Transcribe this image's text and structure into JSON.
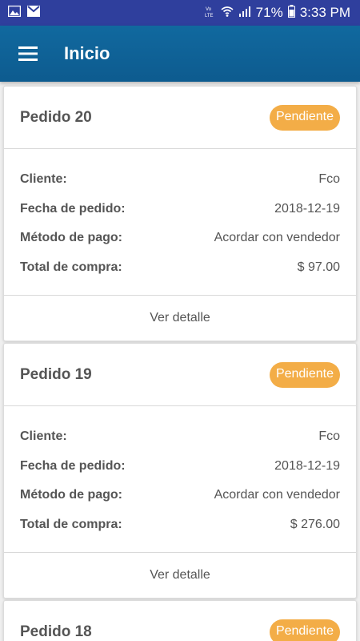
{
  "status_bar": {
    "battery": "71%",
    "time": "3:33 PM",
    "icons": [
      "image-icon",
      "gmail-icon",
      "volte-icon",
      "wifi-icon",
      "signal-icon",
      "battery-icon"
    ]
  },
  "app_bar": {
    "title": "Inicio",
    "menu_icon": "hamburger-icon"
  },
  "labels": {
    "client": "Cliente:",
    "date": "Fecha de pedido:",
    "payment": "Método de pago:",
    "total": "Total de compra:",
    "details": "Ver detalle"
  },
  "orders": [
    {
      "title": "Pedido 20",
      "status": "Pendiente",
      "client": "Fco",
      "date": "2018-12-19",
      "payment": "Acordar con vendedor",
      "total": "$ 97.00"
    },
    {
      "title": "Pedido 19",
      "status": "Pendiente",
      "client": "Fco",
      "date": "2018-12-19",
      "payment": "Acordar con vendedor",
      "total": "$ 276.00"
    },
    {
      "title": "Pedido 18",
      "status": "Pendiente"
    }
  ],
  "colors": {
    "status_bar": "#2f3f9d",
    "app_bar": "#11699f",
    "badge": "#f3ad47",
    "background": "#efefef"
  }
}
